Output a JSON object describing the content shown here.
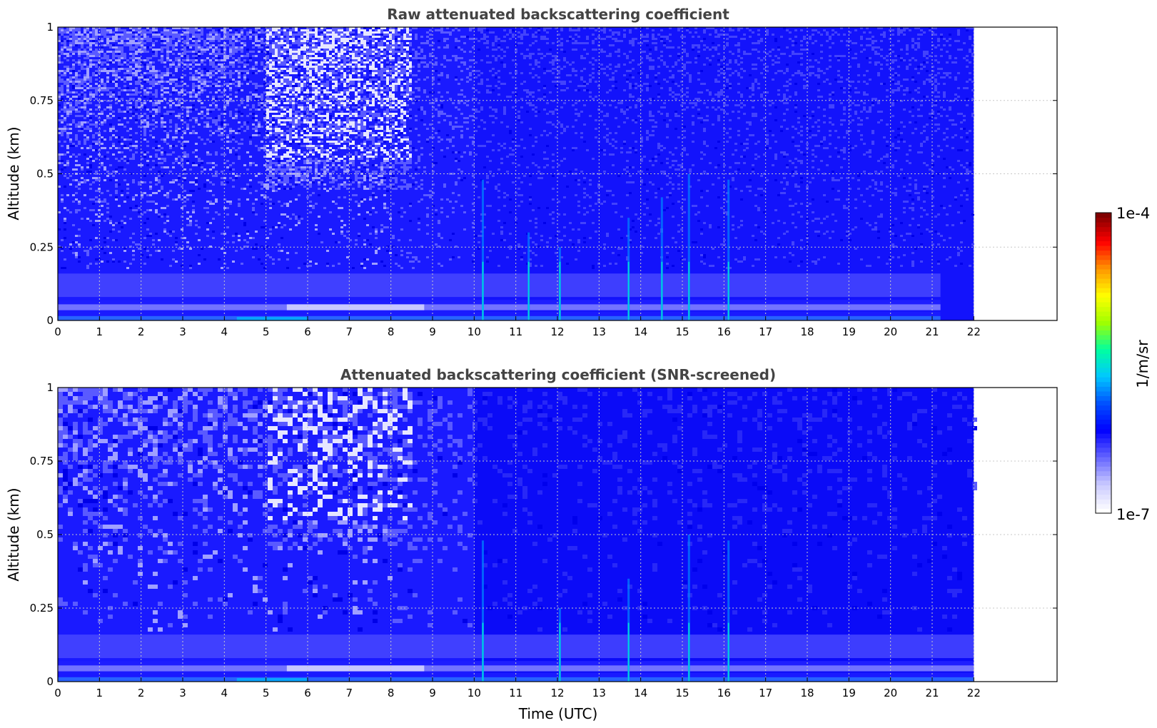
{
  "chart_data": [
    {
      "type": "heatmap",
      "title": "Raw attenuated backscattering coefficient",
      "xlabel": "",
      "ylabel": "Altitude (km)",
      "xlim": [
        0,
        24
      ],
      "ylim": [
        0,
        1
      ],
      "data_end_hour": 22,
      "x_ticks": [
        "0",
        "1",
        "2",
        "3",
        "4",
        "5",
        "6",
        "7",
        "8",
        "9",
        "10",
        "11",
        "12",
        "13",
        "14",
        "15",
        "16",
        "17",
        "18",
        "19",
        "20",
        "21",
        "22"
      ],
      "y_ticks": [
        "0",
        "0.25",
        "0.5",
        "0.75",
        "1"
      ],
      "grid": true,
      "features": {
        "clear_region_hours": [
          5,
          8.5
        ],
        "spikes": [
          {
            "hour": 10.2,
            "top_km": 0.48
          },
          {
            "hour": 11.3,
            "top_km": 0.3
          },
          {
            "hour": 12.05,
            "top_km": 0.25
          },
          {
            "hour": 13.7,
            "top_km": 0.35
          },
          {
            "hour": 14.5,
            "top_km": 0.42
          },
          {
            "hour": 15.15,
            "top_km": 0.5
          },
          {
            "hour": 16.1,
            "top_km": 0.48
          }
        ]
      }
    },
    {
      "type": "heatmap",
      "title": "Attenuated backscattering coefficient (SNR-screened)",
      "xlabel": "Time (UTC)",
      "ylabel": "Altitude (km)",
      "xlim": [
        0,
        24
      ],
      "ylim": [
        0,
        1
      ],
      "data_end_hour": 22,
      "x_ticks": [
        "0",
        "1",
        "2",
        "3",
        "4",
        "5",
        "6",
        "7",
        "8",
        "9",
        "10",
        "11",
        "12",
        "13",
        "14",
        "15",
        "16",
        "17",
        "18",
        "19",
        "20",
        "21",
        "22"
      ],
      "y_ticks": [
        "0",
        "0.25",
        "0.5",
        "0.75",
        "1"
      ],
      "grid": true,
      "features": {
        "clear_region_hours": [
          5,
          8.5
        ],
        "spikes": [
          {
            "hour": 10.2,
            "top_km": 0.48
          },
          {
            "hour": 12.05,
            "top_km": 0.25
          },
          {
            "hour": 13.7,
            "top_km": 0.35
          },
          {
            "hour": 15.15,
            "top_km": 0.5
          },
          {
            "hour": 16.1,
            "top_km": 0.48
          }
        ]
      }
    }
  ],
  "colorbar": {
    "max_label": "1e-4",
    "min_label": "1e-7",
    "label": "1/m/sr",
    "scale": "log",
    "colormap": "jet",
    "stops": [
      "#ffffff",
      "#c8c8ff",
      "#6464ff",
      "#0000ff",
      "#0050ff",
      "#00c8ff",
      "#00ffa0",
      "#a0ff00",
      "#ffff00",
      "#ff9600",
      "#ff0000",
      "#800000"
    ]
  }
}
